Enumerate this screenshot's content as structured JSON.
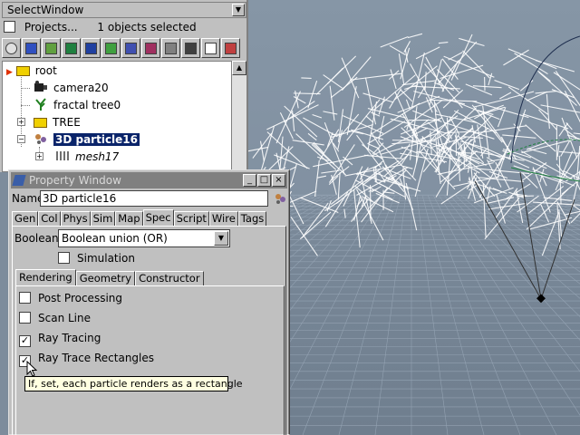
{
  "select_window": {
    "title": "SelectWindow",
    "projects_label": "Projects...",
    "selection_count": "1 objects selected",
    "toolbar_icons": [
      "sphere-icon",
      "cube-icon",
      "landscape-icon",
      "mountain-icon",
      "save-icon",
      "grid-icon",
      "film-icon",
      "render-icon",
      "gear-tool-icon",
      "network-icon",
      "crop-icon",
      "layers-icon"
    ],
    "tree": {
      "root": "root",
      "items": [
        "camera20",
        "fractal tree0",
        "TREE",
        "3D particle16",
        "mesh17"
      ]
    }
  },
  "property_window": {
    "title": "Property Window",
    "name_label": "Name",
    "name_value": "3D particle16",
    "tabs": [
      "Gen",
      "Col",
      "Phys",
      "Sim",
      "Map",
      "Spec",
      "Script",
      "Wire",
      "Tags"
    ],
    "active_tab": "Spec",
    "boolean_label": "Boolean",
    "boolean_value": "Boolean union (OR)",
    "simulation_label": "Simulation",
    "subtabs": [
      "Rendering",
      "Geometry",
      "Constructor"
    ],
    "options": [
      {
        "label": "Post Processing",
        "checked": false
      },
      {
        "label": "Scan Line",
        "checked": false
      },
      {
        "label": "Ray Tracing",
        "checked": true
      },
      {
        "label": "Ray Trace Rectangles",
        "checked": true
      }
    ],
    "tooltip": "If, set, each particle renders as a rectangle"
  },
  "check_mark": "✓",
  "colors": {
    "selection": "#0a246a",
    "panel": "#c0c0c0",
    "viewport": "#7d8c9c",
    "tooltip_bg": "#ffffe1"
  }
}
